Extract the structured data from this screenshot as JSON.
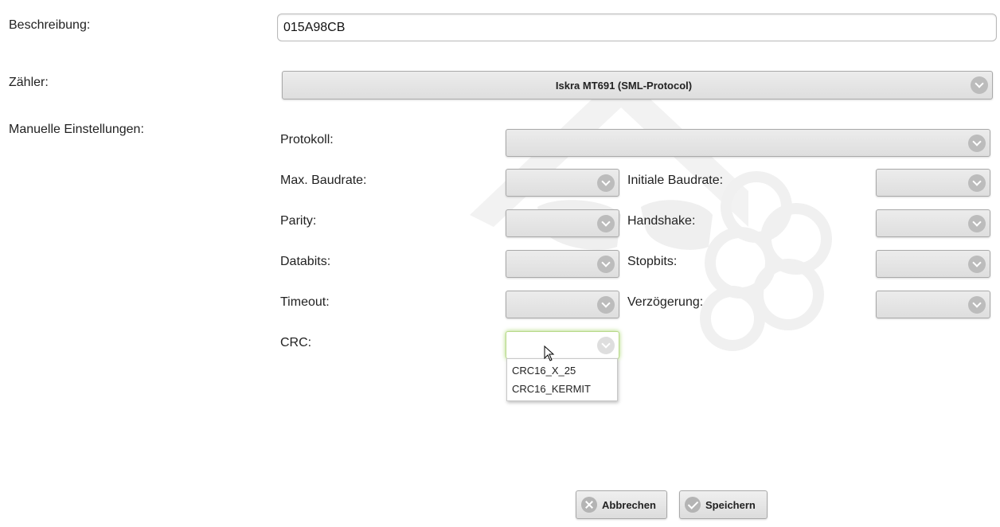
{
  "fields": {
    "beschreibung": {
      "label": "Beschreibung:",
      "value": "015A98CB"
    },
    "zaehler": {
      "label": "Zähler:",
      "selected": "Iskra MT691 (SML-Protocol)"
    },
    "manuelle_label": "Manuelle Einstellungen:"
  },
  "manual": {
    "protokoll": {
      "label": "Protokoll:",
      "value": ""
    },
    "max_baudrate": {
      "label": "Max. Baudrate:",
      "value": ""
    },
    "initiale_baudrate": {
      "label": "Initiale Baudrate:",
      "value": ""
    },
    "parity": {
      "label": "Parity:",
      "value": ""
    },
    "handshake": {
      "label": "Handshake:",
      "value": ""
    },
    "databits": {
      "label": "Databits:",
      "value": ""
    },
    "stopbits": {
      "label": "Stopbits:",
      "value": ""
    },
    "timeout": {
      "label": "Timeout:",
      "value": ""
    },
    "verzoegerung": {
      "label": "Verzögerung:",
      "value": ""
    },
    "crc": {
      "label": "CRC:",
      "value": "",
      "options": [
        "CRC16_X_25",
        "CRC16_KERMIT"
      ]
    }
  },
  "buttons": {
    "cancel": {
      "label": "Abbrechen",
      "icon": "close-icon"
    },
    "save": {
      "label": "Speichern",
      "icon": "check-icon"
    }
  },
  "colors": {
    "focus_glow": "#a5d46a",
    "select_bg": "#e3e3e3",
    "watermark": "#f3f3f3"
  }
}
